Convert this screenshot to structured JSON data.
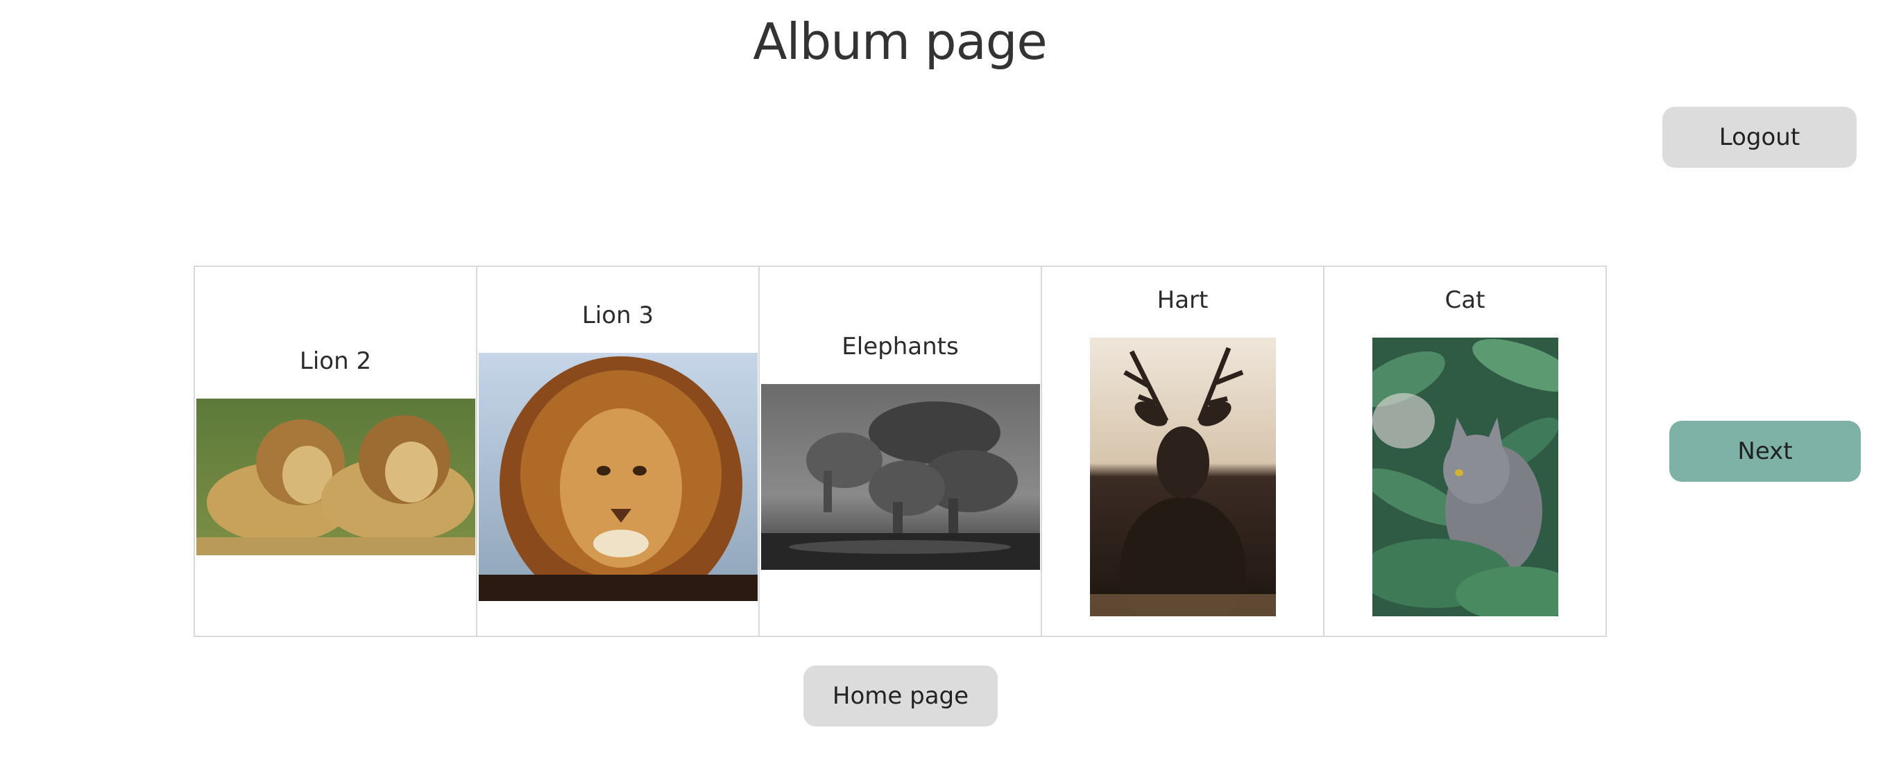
{
  "page": {
    "title": "Album page"
  },
  "buttons": {
    "logout": "Logout",
    "next": "Next",
    "home": "Home page"
  },
  "album": {
    "items": [
      {
        "label": "Lion 2",
        "icon": "lions-photo"
      },
      {
        "label": "Lion 3",
        "icon": "lion-portrait-photo"
      },
      {
        "label": "Elephants",
        "icon": "elephants-photo"
      },
      {
        "label": "Hart",
        "icon": "deer-photo"
      },
      {
        "label": "Cat",
        "icon": "cat-photo"
      }
    ]
  },
  "colors": {
    "next_button": "#7fb2a6",
    "neutral_button": "#dcdcdc",
    "table_border": "#d9d9d9"
  }
}
